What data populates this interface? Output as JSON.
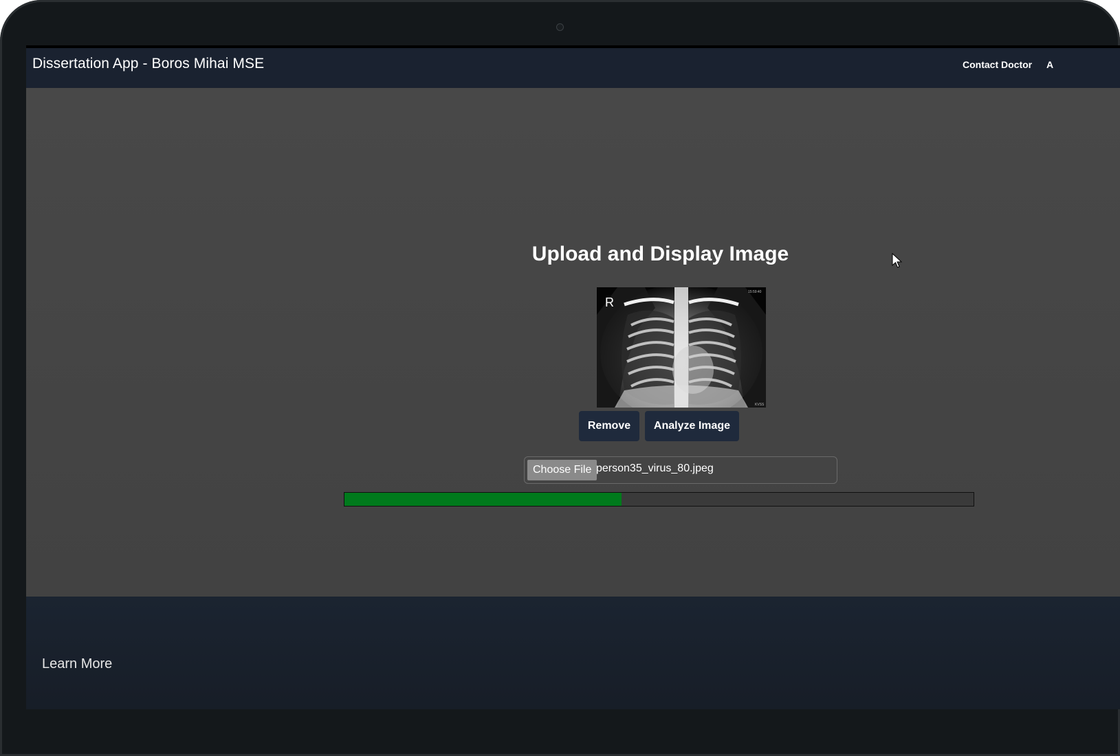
{
  "app": {
    "title": "Dissertation App - Boros Mihai MSE"
  },
  "nav": {
    "contact_label": "Contact Doctor",
    "next_label": "A"
  },
  "upload": {
    "heading": "Upload and Display Image",
    "preview_marker": "R",
    "preview_timestamp": "15:59:40",
    "preview_corner_tag": "KVSS",
    "remove_label": "Remove",
    "analyze_label": "Analyze Image",
    "choose_file_label": "Choose File",
    "file_name": "person35_virus_80.jpeg",
    "progress_percent": 44
  },
  "footer": {
    "learn_more_label": "Learn More"
  },
  "colors": {
    "navbar": "#1a2230",
    "button": "#1f2a3c",
    "progress_fill": "#007a1c",
    "page_background": "#454545"
  },
  "icons": {
    "cursor": "mouse-pointer-icon",
    "camera": "webcam-dot"
  }
}
